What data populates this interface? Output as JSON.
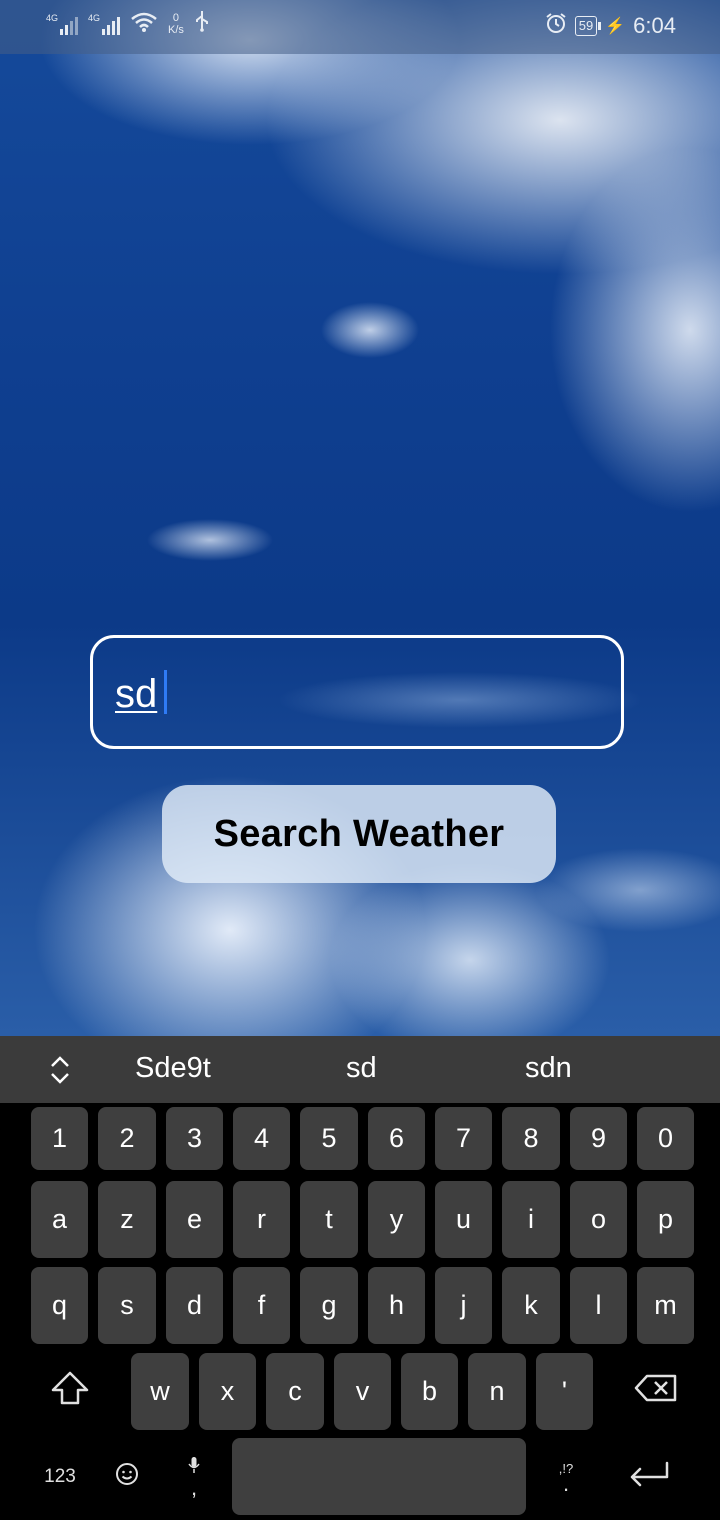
{
  "status_bar": {
    "network_1": "4G",
    "network_2": "4G",
    "speed_value": "0",
    "speed_unit": "K/s",
    "battery": "59",
    "time": "6:04",
    "icons": [
      "signal-icon",
      "wifi-icon",
      "usb-icon",
      "alarm-icon",
      "battery-icon",
      "charging-icon"
    ]
  },
  "search": {
    "value": "sd",
    "button_label": "Search Weather"
  },
  "keyboard": {
    "suggestions": [
      "Sde9t",
      "sd",
      "sdn"
    ],
    "row_numbers": [
      "1",
      "2",
      "3",
      "4",
      "5",
      "6",
      "7",
      "8",
      "9",
      "0"
    ],
    "row_1": [
      "a",
      "z",
      "e",
      "r",
      "t",
      "y",
      "u",
      "i",
      "o",
      "p"
    ],
    "row_2": [
      "q",
      "s",
      "d",
      "f",
      "g",
      "h",
      "j",
      "k",
      "l",
      "m"
    ],
    "row_3": [
      "w",
      "x",
      "c",
      "v",
      "b",
      "n",
      "'"
    ],
    "numbers_toggle": "123",
    "comma": ",",
    "punct_top": ",!?",
    "period": "."
  }
}
